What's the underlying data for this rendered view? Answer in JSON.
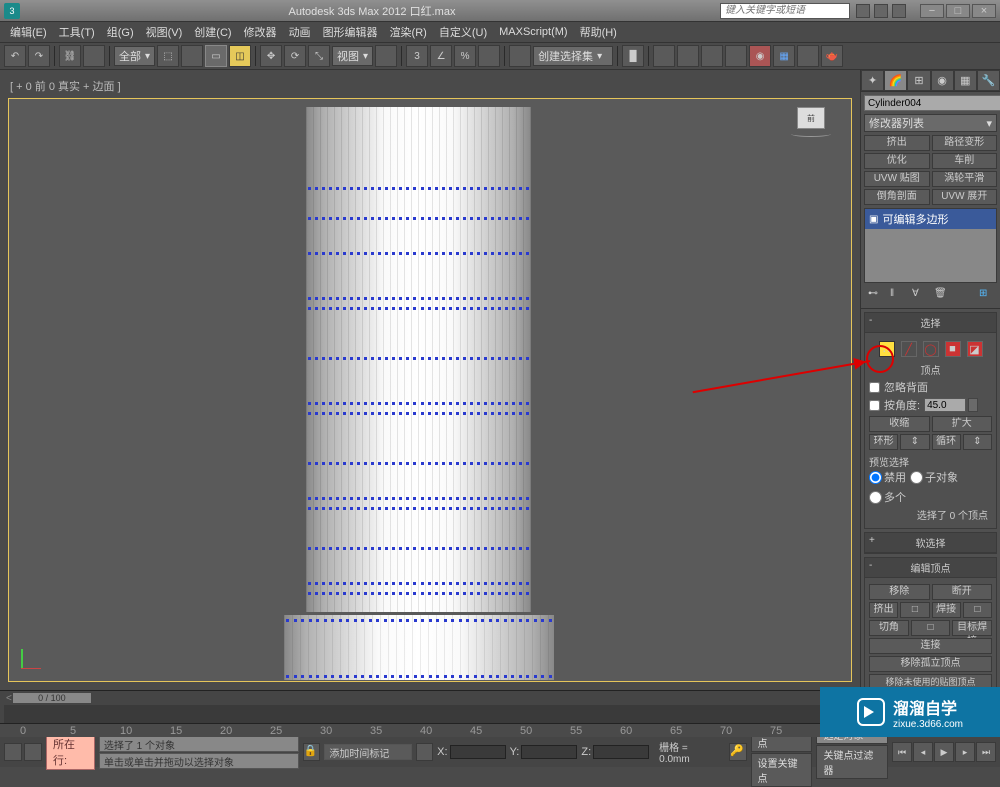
{
  "titlebar": {
    "app_icon": "3",
    "title": "Autodesk 3ds Max 2012          口红.max",
    "search_placeholder": "键入关键字或短语"
  },
  "menus": [
    "编辑(E)",
    "工具(T)",
    "组(G)",
    "视图(V)",
    "创建(C)",
    "修改器",
    "动画",
    "图形编辑器",
    "渲染(R)",
    "自定义(U)",
    "MAXScript(M)",
    "帮助(H)"
  ],
  "toolbar": {
    "filter": "全部",
    "view": "视图",
    "selection_set": "创建选择集"
  },
  "viewport": {
    "label": "[ + 0 前 0 真实 + 边面 ]",
    "viewcube": "前"
  },
  "cmdpanel": {
    "object_name": "Cylinder004",
    "modifier_list": "修改器列表",
    "mod_buttons": [
      "挤出",
      "路径变形",
      "优化",
      "车削",
      "UVW 贴图",
      "涡轮平滑",
      "倒角剖面",
      "UVW 展开"
    ],
    "stack_item": "可编辑多边形",
    "rollouts": {
      "select": {
        "title": "选择",
        "ignore_back": "忽略背面",
        "by_angle": "按角度:",
        "angle_val": "45.0",
        "shrink": "收缩",
        "grow": "扩大",
        "ring": "环形",
        "loop": "循环",
        "preview_label": "预览选择",
        "preview": {
          "off": "禁用",
          "sub": "子对象",
          "multi": "多个"
        },
        "status": "选择了 0 个顶点"
      },
      "softsel": "软选择",
      "editvert": {
        "title": "编辑顶点",
        "remove": "移除",
        "break": "断开",
        "extrude": "挤出",
        "weld": "焊接",
        "chamfer": "切角",
        "target_weld": "目标焊接",
        "connect": "连接",
        "remove_iso": "移除孤立顶点",
        "remove_unused": "移除未使用的贴图顶点"
      }
    }
  },
  "bottom": {
    "slider": "0 / 100",
    "ruler_ticks": [
      "0",
      "5",
      "10",
      "15",
      "20",
      "25",
      "30",
      "35",
      "40",
      "45",
      "50",
      "55",
      "60",
      "65",
      "70",
      "75"
    ],
    "status1": "选择了 1 个对象",
    "status2": "单击或单击并拖动以选择对象",
    "add_time": "添加时间标记",
    "x": "X:",
    "y": "Y:",
    "z": "Z:",
    "grid": "栅格 = 0.0mm",
    "autokey": "自动关键点",
    "setkey": "设置关键点",
    "sel_set": "选定对象",
    "keyfilter": "关键点过滤器",
    "current_label": "所在行:"
  },
  "watermark": {
    "cn": "溜溜自学",
    "url": "zixue.3d66.com"
  },
  "subobj_tip": "顶点"
}
